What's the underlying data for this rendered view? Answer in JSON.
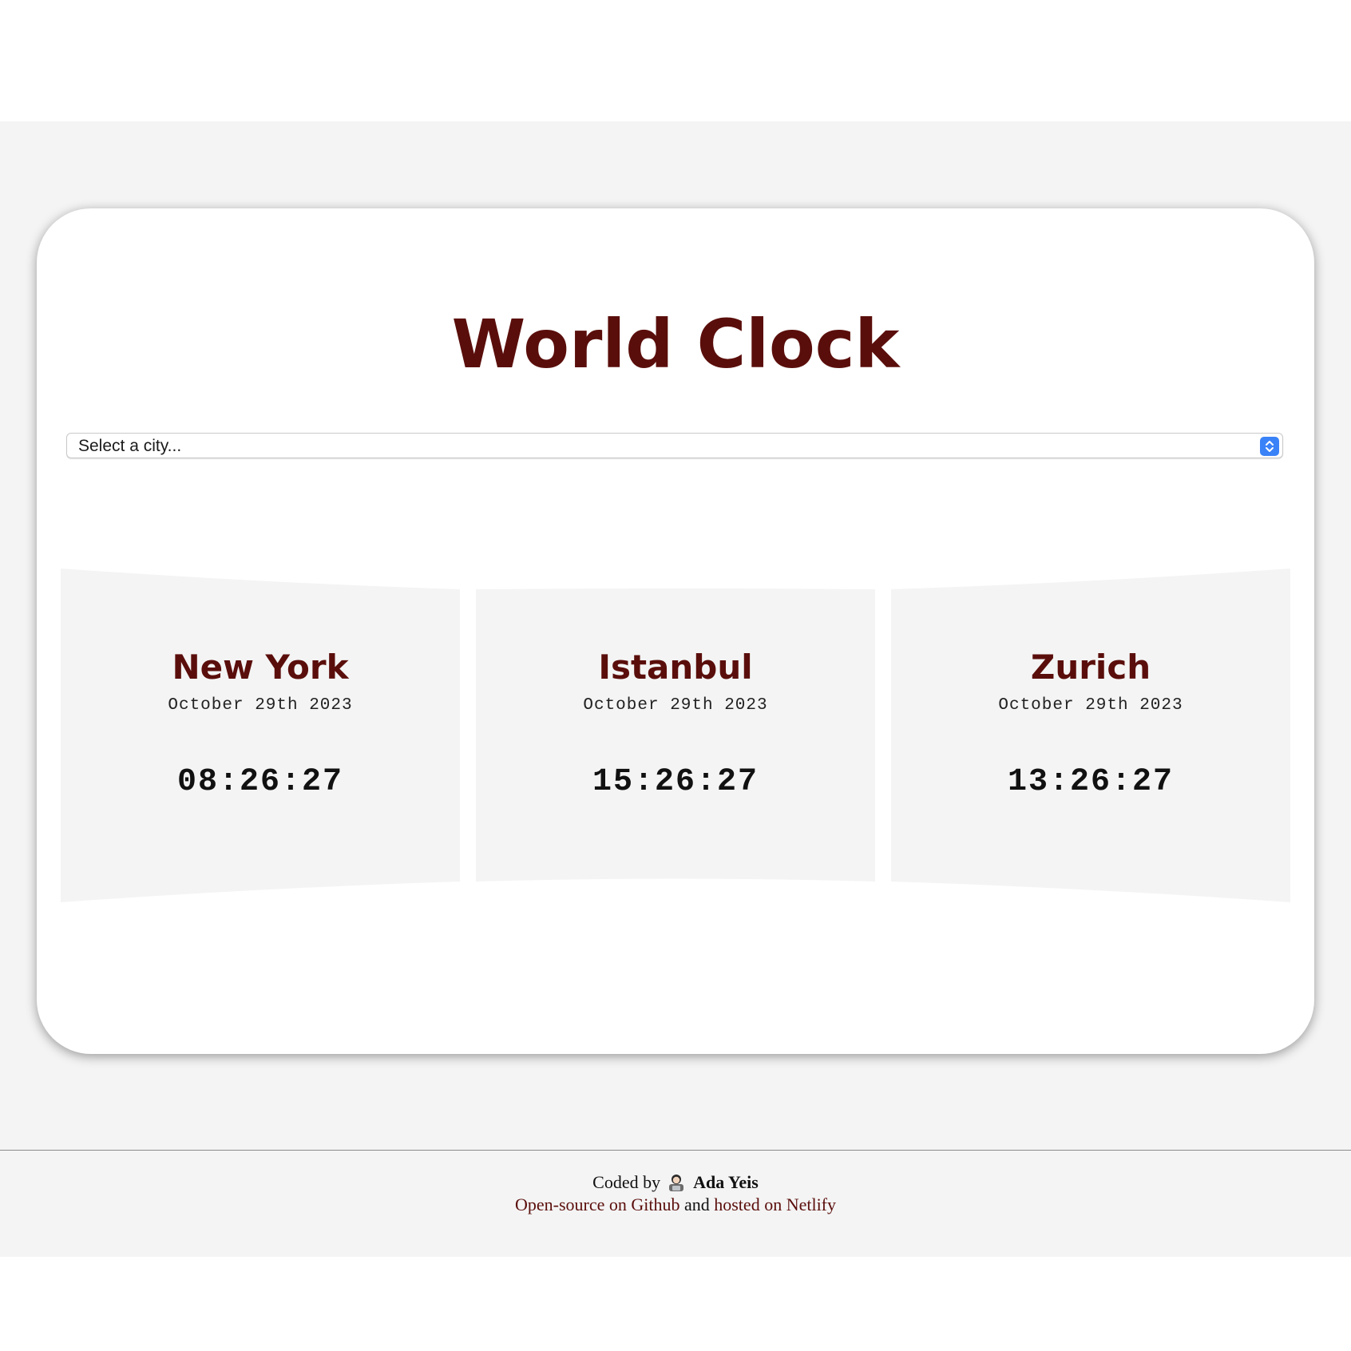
{
  "app": {
    "title": "World Clock",
    "select_placeholder": "Select a city..."
  },
  "cities": [
    {
      "name": "New York",
      "date": "October 29th 2023",
      "time": "08:26:27"
    },
    {
      "name": "Istanbul",
      "date": "October 29th 2023",
      "time": "15:26:27"
    },
    {
      "name": "Zurich",
      "date": "October 29th 2023",
      "time": "13:26:27"
    }
  ],
  "footer": {
    "coded_by": "Coded by",
    "author": "Ada Yeis",
    "github_link": "Open-source on Github",
    "and": "and",
    "netlify_link": "hosted on Netlify"
  },
  "colors": {
    "accent": "#5a0e0b",
    "panel": "#f4f4f4",
    "select_arrow": "#3a82f7"
  },
  "icons": {
    "select_arrow": "chevron-updown-icon",
    "author_avatar": "woman-technologist-emoji"
  }
}
